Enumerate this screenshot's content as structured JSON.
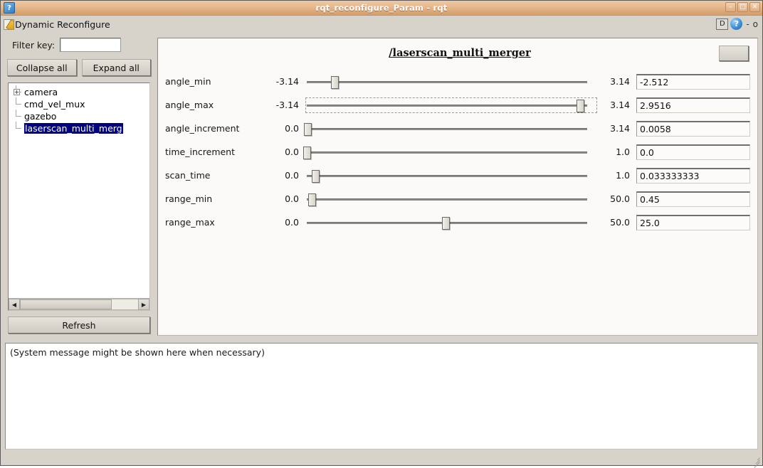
{
  "window": {
    "title": "rqt_reconfigure_Param - rqt",
    "icon": "rqt-app-icon",
    "buttons": [
      {
        "name": "minimize-button",
        "glyph": "–"
      },
      {
        "name": "maximize-button",
        "glyph": "□"
      },
      {
        "name": "close-button",
        "glyph": "✕"
      }
    ]
  },
  "plugin_toolbar": {
    "title": "Dynamic Reconfigure",
    "icon": "dynamic-reconfigure-icon",
    "dock_label": "D",
    "help_label": "?",
    "minimize_glyph": "-",
    "close_glyph": "o"
  },
  "sidebar": {
    "filter_label": "Filter key:",
    "filter_value": "",
    "filter_placeholder": "",
    "collapse_all_label": "Collapse all",
    "expand_all_label": "Expand all",
    "refresh_label": "Refresh",
    "scroll_left_glyph": "◀",
    "scroll_right_glyph": "▶",
    "tree": [
      {
        "label": "camera",
        "expandable": true,
        "selected": false
      },
      {
        "label": "cmd_vel_mux",
        "expandable": false,
        "selected": false
      },
      {
        "label": "gazebo",
        "expandable": false,
        "selected": false
      },
      {
        "label": "laserscan_multi_merg",
        "expandable": false,
        "selected": true
      }
    ]
  },
  "params_panel": {
    "group_title": "/laserscan_multi_merger",
    "collapse_button_label": "",
    "rows": [
      {
        "name": "angle_min",
        "min": "-3.14",
        "max": "3.14",
        "value": "-2.512",
        "handle_pct": 10.2,
        "focused": false
      },
      {
        "name": "angle_max",
        "min": "-3.14",
        "max": "3.14",
        "value": "2.9516",
        "handle_pct": 97.0,
        "focused": true
      },
      {
        "name": "angle_increment",
        "min": "0.0",
        "max": "3.14",
        "value": "0.0058",
        "handle_pct": 0.8,
        "focused": false
      },
      {
        "name": "time_increment",
        "min": "0.0",
        "max": "1.0",
        "value": "0.0",
        "handle_pct": 0.6,
        "focused": false
      },
      {
        "name": "scan_time",
        "min": "0.0",
        "max": "1.0",
        "value": "0.033333333",
        "handle_pct": 3.6,
        "focused": false
      },
      {
        "name": "range_min",
        "min": "0.0",
        "max": "50.0",
        "value": "0.45",
        "handle_pct": 2.2,
        "focused": false
      },
      {
        "name": "range_max",
        "min": "0.0",
        "max": "50.0",
        "value": "25.0",
        "handle_pct": 49.5,
        "focused": false
      }
    ]
  },
  "message_area": {
    "text": "(System message might be shown here when necessary)"
  },
  "colors": {
    "titlebar_start": "#f0c9a4",
    "titlebar_end": "#d49f6d",
    "window_bg": "#d7d3cb",
    "panel_bg": "#fbfaf8",
    "selection_bg": "#000080",
    "selection_fg": "#ffffff"
  }
}
